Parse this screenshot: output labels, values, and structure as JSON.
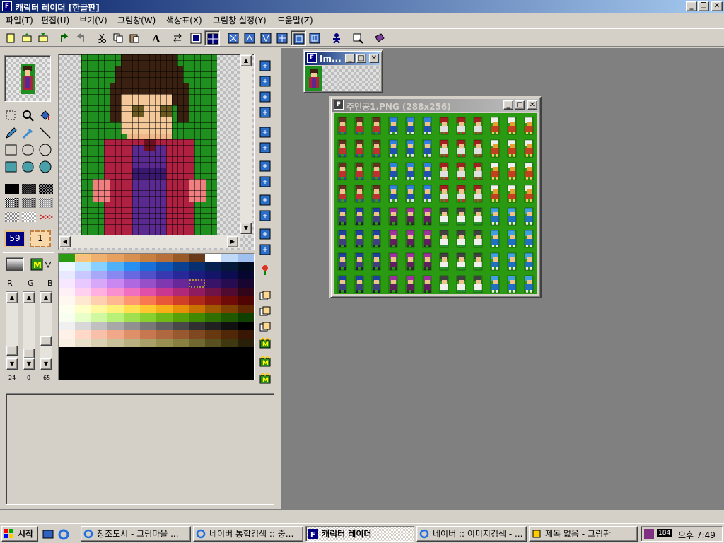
{
  "window": {
    "title": "캐릭터 레이더 [한글판]",
    "icon_label": "F"
  },
  "menu": [
    "파일(T)",
    "편집(U)",
    "보기(V)",
    "그림창(W)",
    "색상표(X)",
    "그림창 설정(Y)",
    "도움말(Z)"
  ],
  "toolbar_icons": [
    "new-icon",
    "open-icon",
    "save-icon",
    "undo-icon",
    "redo-icon",
    "cut-icon",
    "copy-icon",
    "paste-icon",
    "text-icon",
    "swap-icon",
    "grid-icon",
    "grid2-icon",
    "flip1-icon",
    "flip2-icon",
    "flip3-icon",
    "flip4-icon",
    "flip5-icon",
    "flip6-icon",
    "character-icon",
    "preview-icon",
    "book-icon"
  ],
  "tools": {
    "counter_left": "59",
    "counter_right": "1"
  },
  "rgb": {
    "labels": [
      "R",
      "G",
      "B"
    ],
    "values": [
      "24",
      "0",
      "65"
    ]
  },
  "colors": {
    "canvas_green": "#1f8f1f",
    "mdi_bg": "#808080",
    "title_active": "#0a246a",
    "sprite_green": "#2a9a12"
  },
  "mdi": {
    "small_window_title": "Im...",
    "sprite_window_title": "주인공1.PNG (288x256)"
  },
  "taskbar": {
    "start": "시작",
    "tasks": [
      "창조도시 - 그림마을 ...",
      "네이버 통합검색 :: 중...",
      "캐릭터 레이더",
      "네이버 :: 이미지검색 - ...",
      "제목 없음 - 그림판"
    ],
    "tray_number": "184",
    "clock": "오후 7:49"
  }
}
